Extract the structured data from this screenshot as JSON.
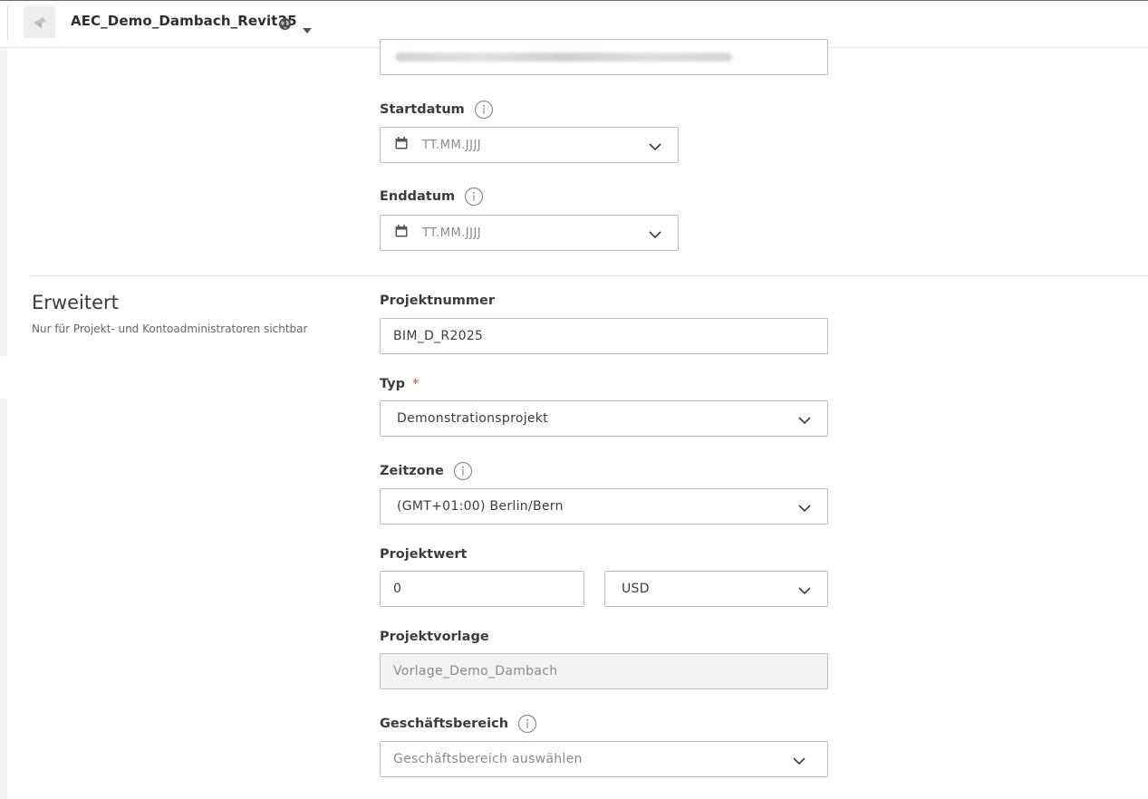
{
  "header": {
    "project_name": "AEC_Demo_Dambach_Revit25",
    "icons": [
      "project-logo-icon",
      "globe-icon",
      "caret-down-icon"
    ]
  },
  "address": {
    "value_obscured": true
  },
  "start_date": {
    "label": "Startdatum",
    "placeholder": "TT.MM.JJJJ"
  },
  "end_date": {
    "label": "Enddatum",
    "placeholder": "TT.MM.JJJJ"
  },
  "advanced": {
    "title": "Erweitert",
    "subtitle": "Nur für Projekt- und Kontoadministratoren sichtbar"
  },
  "project_number": {
    "label": "Projektnummer",
    "value": "BIM_D_R2025"
  },
  "type": {
    "label": "Typ",
    "required_marker": "*",
    "value": "Demonstrationsprojekt"
  },
  "timezone": {
    "label": "Zeitzone",
    "value": "(GMT+01:00) Berlin/Bern"
  },
  "project_value": {
    "label": "Projektwert",
    "amount": "0",
    "currency": "USD"
  },
  "template": {
    "label": "Projektvorlage",
    "value": "Vorlage_Demo_Dambach"
  },
  "business_unit": {
    "label": "Geschäftsbereich",
    "placeholder": "Geschäftsbereich auswählen"
  },
  "colors": {
    "required": "#d74e3b",
    "border": "#bdbdbd",
    "disabled_bg": "#f3f3f3"
  }
}
